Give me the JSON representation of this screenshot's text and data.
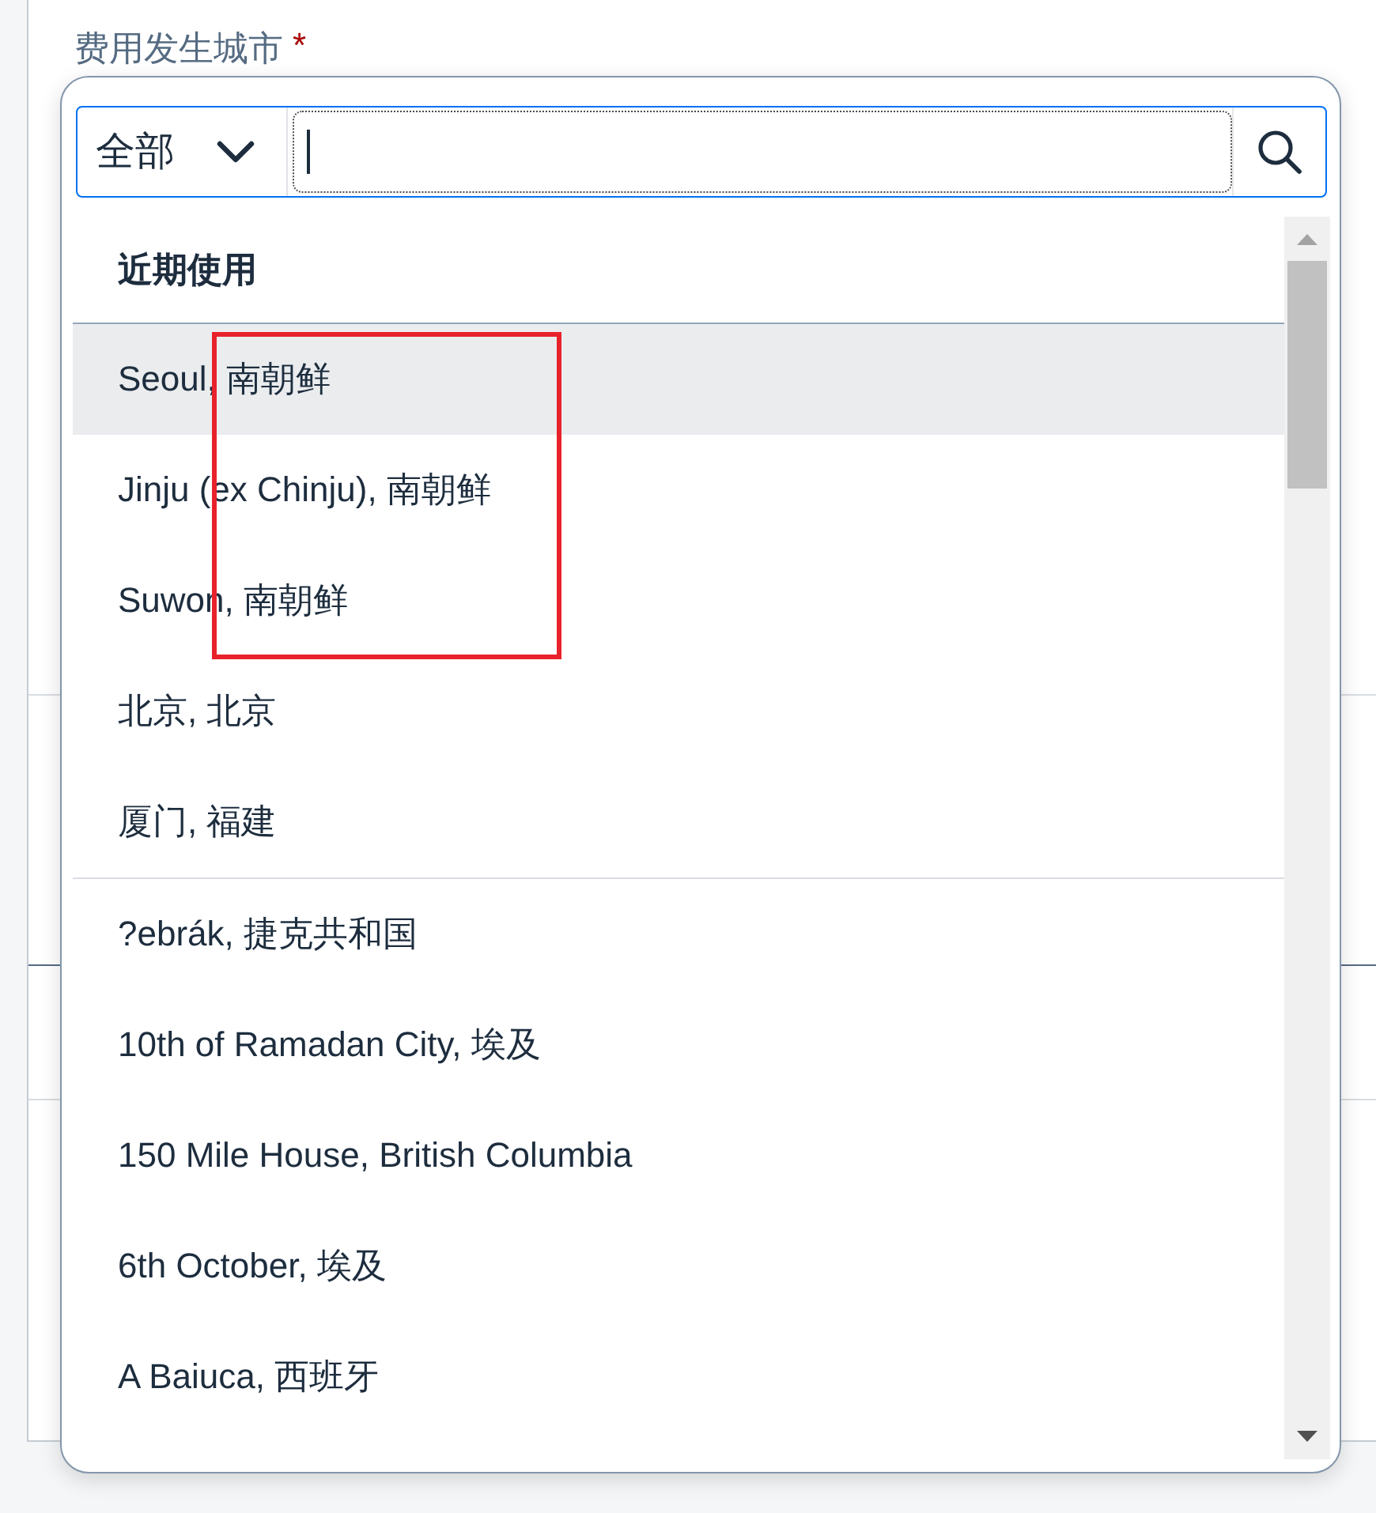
{
  "field": {
    "label": "费用发生城市",
    "required_mark": "*"
  },
  "search": {
    "scope": "全部"
  },
  "groups": [
    {
      "title": "近期使用",
      "items": [
        {
          "label": "Seoul, 南朝鲜",
          "selected": true
        },
        {
          "label": "Jinju (ex Chinju), 南朝鲜",
          "selected": false
        },
        {
          "label": "Suwon, 南朝鲜",
          "selected": false
        },
        {
          "label": "北京, 北京",
          "selected": false
        },
        {
          "label": "厦门, 福建",
          "selected": false
        }
      ]
    },
    {
      "items": [
        {
          "label": "?ebrák, 捷克共和国",
          "selected": false
        },
        {
          "label": "10th of Ramadan City, 埃及",
          "selected": false
        },
        {
          "label": "150 Mile House, British Columbia",
          "selected": false
        },
        {
          "label": "6th October, 埃及",
          "selected": false
        },
        {
          "label": "A Baiuca, 西班牙",
          "selected": false
        }
      ]
    }
  ]
}
